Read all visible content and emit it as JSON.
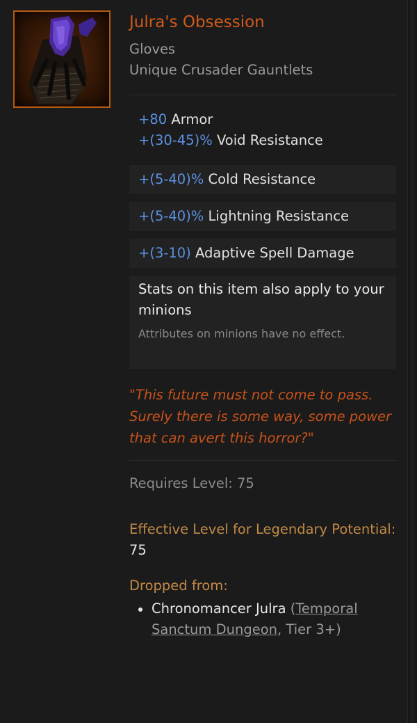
{
  "item": {
    "name": "Julra's Obsession",
    "slot": "Gloves",
    "base": "Unique Crusader Gauntlets",
    "icon": "crusader-gauntlets-icon"
  },
  "implicits": [
    {
      "value": "+80",
      "text": "Armor"
    },
    {
      "value": "+(30-45)%",
      "text": "Void Resistance"
    }
  ],
  "affixes": [
    {
      "value": "+(5-40)%",
      "text": "Cold Resistance"
    },
    {
      "value": "+(5-40)%",
      "text": "Lightning Resistance"
    },
    {
      "value": "+(3-10)",
      "text": "Adaptive Spell Damage"
    }
  ],
  "minion": {
    "title": "Stats on this item also apply to your minions",
    "note": "Attributes on minions have no effect."
  },
  "flavor": "\"This future must not come to pass. Surely there is some way, some power that can avert this horror?\"",
  "requirements": {
    "level_label": "Requires Level:",
    "level_value": "75"
  },
  "legendary": {
    "label": "Effective Level for Legendary Potential:",
    "value": "75"
  },
  "drops": {
    "label": "Dropped from:",
    "source": "Chronomancer Julra",
    "open_paren": "(",
    "location": "Temporal Sanctum Dungeon",
    "tier": ", Tier 3+)"
  },
  "colors": {
    "unique": "#d05a1a",
    "value": "#5b91e2",
    "label_gold": "#c28a47",
    "flavor": "#c9521b"
  }
}
